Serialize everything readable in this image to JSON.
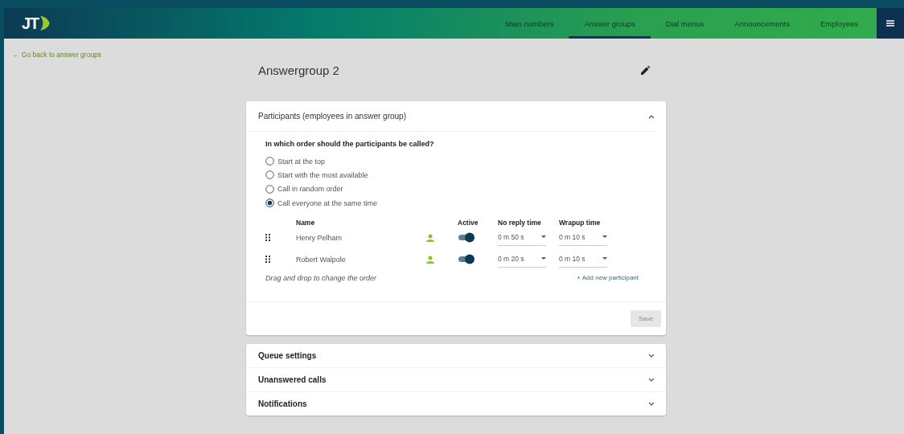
{
  "header": {
    "logo": "JT",
    "nav": [
      {
        "label": "Main numbers",
        "selected": false
      },
      {
        "label": "Answer groups",
        "selected": true
      },
      {
        "label": "Dial menus",
        "selected": false
      },
      {
        "label": "Announcements",
        "selected": false
      },
      {
        "label": "Employees",
        "selected": false
      }
    ]
  },
  "back_link": "← Go back to answer groups",
  "title": "Answergroup 2",
  "participants": {
    "title": "Participants (employees in answer group)",
    "expanded": true,
    "question": "In which order should the participants be called?",
    "options": [
      {
        "label": "Start at the top",
        "selected": false
      },
      {
        "label": "Start with the most available",
        "selected": false
      },
      {
        "label": "Call in random order",
        "selected": false
      },
      {
        "label": "Call everyone at the same time",
        "selected": true
      }
    ],
    "columns": [
      "Name",
      "Active",
      "No reply time",
      "Wrapup time"
    ],
    "rows": [
      {
        "name": "Henry Pelham",
        "active": true,
        "no_reply": "0 m 50 s",
        "wrapup": "0 m 10 s"
      },
      {
        "name": "Robert Walpole",
        "active": true,
        "no_reply": "0 m 20 s",
        "wrapup": "0 m 10 s"
      }
    ],
    "hint": "Drag and drop to change the order",
    "add": "+ Add new participant",
    "save": {
      "label": "Save",
      "disabled": true
    }
  },
  "sections": [
    {
      "title": "Queue settings",
      "expanded": false
    },
    {
      "title": "Unanswered calls",
      "expanded": false
    },
    {
      "title": "Notifications",
      "expanded": false
    }
  ]
}
